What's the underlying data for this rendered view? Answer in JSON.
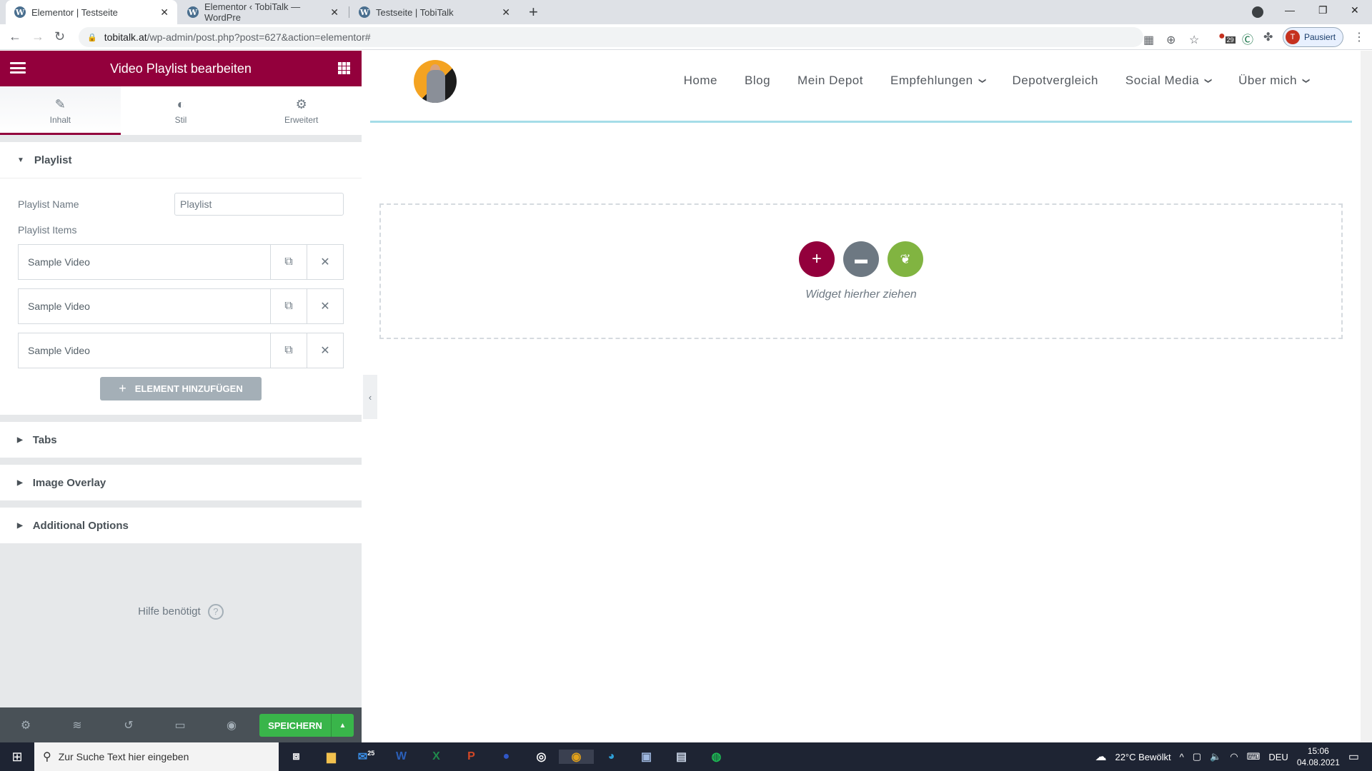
{
  "browser": {
    "tabs": [
      {
        "title": "Elementor | Testseite",
        "active": true
      },
      {
        "title": "Elementor ‹ TobiTalk — WordPre",
        "active": false
      },
      {
        "title": "Testseite | TobiTalk",
        "active": false
      }
    ],
    "url_host": "tobitalk.at",
    "url_path": "/wp-admin/post.php?post=627&action=elementor#",
    "extension_badge": "29",
    "profile_initial": "T",
    "profile_status": "Pausiert"
  },
  "panel": {
    "title": "Video Playlist bearbeiten",
    "tabs": [
      {
        "label": "Inhalt",
        "icon": "pencil-icon",
        "active": true
      },
      {
        "label": "Stil",
        "icon": "contrast-icon",
        "active": false
      },
      {
        "label": "Erweitert",
        "icon": "gear-icon",
        "active": false
      }
    ],
    "playlist_section": {
      "title": "Playlist",
      "name_label": "Playlist Name",
      "name_value": "Playlist",
      "items_label": "Playlist Items",
      "items": [
        "Sample Video",
        "Sample Video",
        "Sample Video"
      ],
      "add_button": "ELEMENT HINZUFÜGEN"
    },
    "collapsed_sections": [
      "Tabs",
      "Image Overlay",
      "Additional Options"
    ],
    "help_text": "Hilfe benötigt",
    "save_label": "SPEICHERN"
  },
  "preview": {
    "nav": [
      {
        "label": "Home",
        "dropdown": false
      },
      {
        "label": "Blog",
        "dropdown": false
      },
      {
        "label": "Mein Depot",
        "dropdown": false
      },
      {
        "label": "Empfehlungen",
        "dropdown": true
      },
      {
        "label": "Depotvergleich",
        "dropdown": false
      },
      {
        "label": "Social Media",
        "dropdown": true
      },
      {
        "label": "Über mich",
        "dropdown": true
      }
    ],
    "drop_text": "Widget hierher ziehen",
    "colors": {
      "add": "#93003c",
      "template": "#6d7882",
      "envato": "#81b441"
    }
  },
  "taskbar": {
    "search_placeholder": "Zur Suche Text hier eingeben",
    "mail_badge": "25",
    "weather": "22°C  Bewölkt",
    "lang": "DEU",
    "time": "15:06",
    "date": "04.08.2021"
  }
}
